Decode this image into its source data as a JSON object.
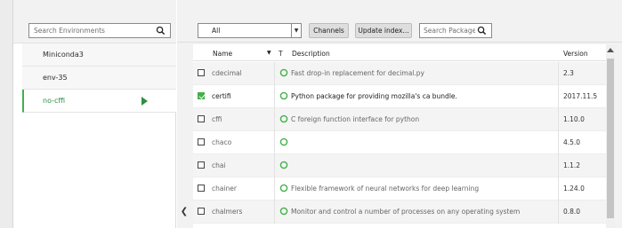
{
  "environments": {
    "search_placeholder": "Search Environments",
    "items": [
      {
        "label": "Miniconda3",
        "active": false
      },
      {
        "label": "env-35",
        "active": false
      },
      {
        "label": "no-cffi",
        "active": true
      }
    ]
  },
  "toolbar": {
    "filter_value": "All",
    "channels_label": "Channels",
    "update_label": "Update index...",
    "search_placeholder": "Search Packages"
  },
  "table": {
    "headers": {
      "name": "Name",
      "t": "T",
      "description": "Description",
      "version": "Version"
    },
    "rows": [
      {
        "name": "cdecimal",
        "checked": false,
        "description": "Fast drop-in replacement for decimal.py",
        "version": "2.3"
      },
      {
        "name": "certifi",
        "checked": true,
        "description": "Python package for providing mozilla's ca bundle.",
        "version": "2017.11.5"
      },
      {
        "name": "cffi",
        "checked": false,
        "description": "C foreign function interface for python",
        "version": "1.10.0"
      },
      {
        "name": "chaco",
        "checked": false,
        "description": "",
        "version": "4.5.0"
      },
      {
        "name": "chai",
        "checked": false,
        "description": "",
        "version": "1.1.2"
      },
      {
        "name": "chainer",
        "checked": false,
        "description": "Flexible framework of neural networks for deep learning",
        "version": "1.24.0"
      },
      {
        "name": "chalmers",
        "checked": false,
        "description": "Monitor and control a number of processes on any operating system",
        "version": "0.8.0"
      }
    ]
  },
  "colors": {
    "accent": "#43b049",
    "active_text": "#2f8f3f"
  },
  "icons": {
    "search": "search-icon",
    "play": "play-icon",
    "status": "status-ring-icon",
    "collapse": "chevron-left-icon"
  }
}
